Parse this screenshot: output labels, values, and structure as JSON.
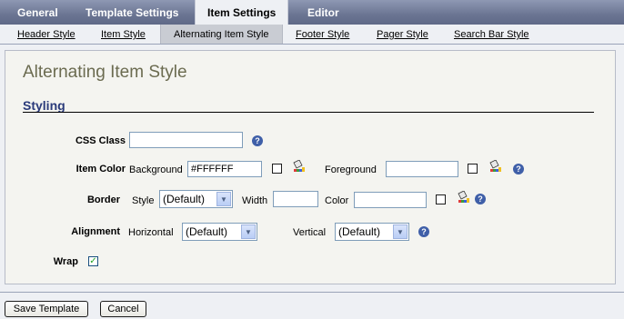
{
  "tabs": [
    "General",
    "Template Settings",
    "Item Settings",
    "Editor"
  ],
  "subtabs": [
    "Header Style",
    "Item Style",
    "Alternating Item Style",
    "Footer Style",
    "Pager Style",
    "Search Bar Style"
  ],
  "page_title": "Alternating Item Style",
  "section_title": "Styling",
  "css_class": {
    "label": "CSS Class",
    "value": ""
  },
  "item_color": {
    "label": "Item Color",
    "background_label": "Background",
    "background_value": "#FFFFFF",
    "foreground_label": "Foreground",
    "foreground_value": ""
  },
  "border": {
    "label": "Border",
    "style_label": "Style",
    "style_value": "(Default)",
    "width_label": "Width",
    "width_value": "",
    "color_label": "Color",
    "color_value": ""
  },
  "alignment": {
    "label": "Alignment",
    "horizontal_label": "Horizontal",
    "horizontal_value": "(Default)",
    "vertical_label": "Vertical",
    "vertical_value": "(Default)"
  },
  "wrap": {
    "label": "Wrap",
    "checked": true
  },
  "buttons": {
    "save": "Save Template",
    "cancel": "Cancel"
  },
  "help_glyph": "?",
  "colors": {
    "tabbar": "#6b7592",
    "section": "#2a3a7a",
    "heading": "#6b6b50"
  }
}
